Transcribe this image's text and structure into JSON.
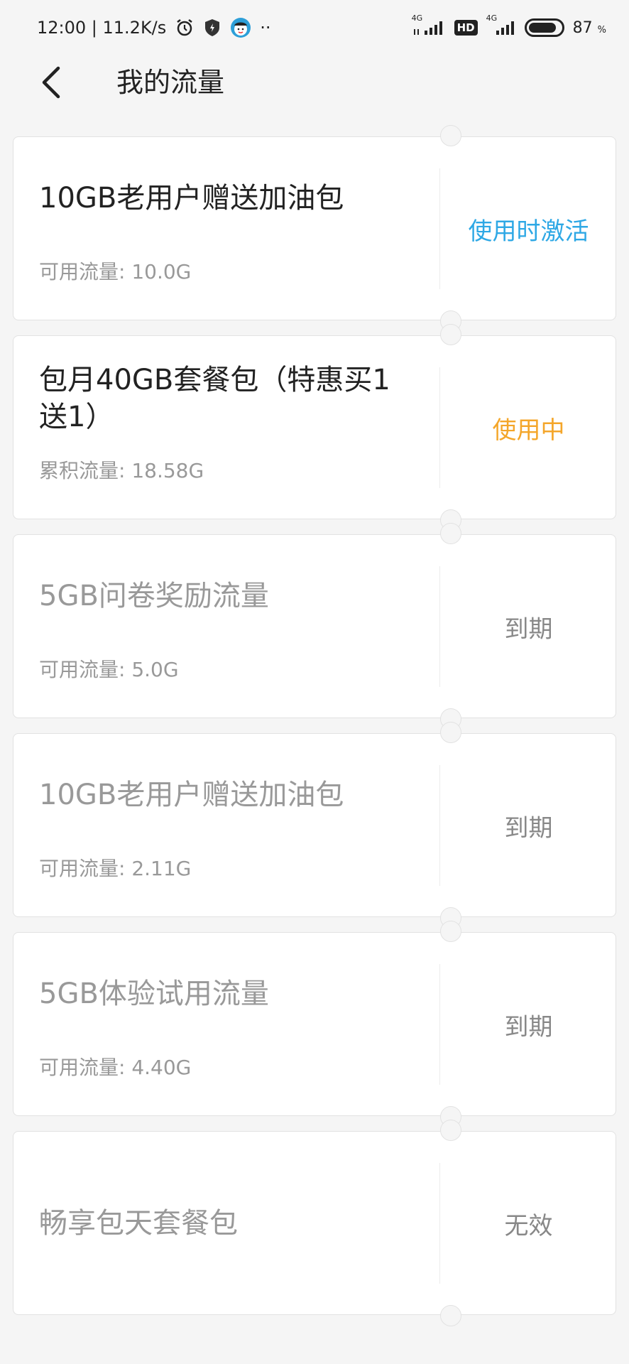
{
  "status_bar": {
    "time_speed": "12:00 | 11.2K/s",
    "more": "··",
    "net1": "4G",
    "hd": "HD",
    "net2": "4G",
    "battery_level": 87,
    "battery_label": "87",
    "battery_unit": "%",
    "icons": [
      "alarm-icon",
      "shield-icon",
      "avatar-icon",
      "signal-icon",
      "battery-icon"
    ]
  },
  "header": {
    "back_icon": "chevron-left-icon",
    "title": "我的流量"
  },
  "colors": {
    "active_blue": "#2ea8e5",
    "in_use_orange": "#f4a62a",
    "expired_gray": "#888888"
  },
  "packages": [
    {
      "title": "10GB老用户赠送加油包",
      "sub": "可用流量: 10.0G",
      "status": "使用时激活"
    },
    {
      "title": "包月40GB套餐包（特惠买1送1）",
      "sub": "累积流量: 18.58G",
      "status": "使用中"
    },
    {
      "title": "5GB问卷奖励流量",
      "sub": "可用流量: 5.0G",
      "status": "到期"
    },
    {
      "title": "10GB老用户赠送加油包",
      "sub": "可用流量: 2.11G",
      "status": "到期"
    },
    {
      "title": "5GB体验试用流量",
      "sub": "可用流量: 4.40G",
      "status": "到期"
    },
    {
      "title": "畅享包天套餐包",
      "sub": "",
      "status": "无效"
    }
  ]
}
